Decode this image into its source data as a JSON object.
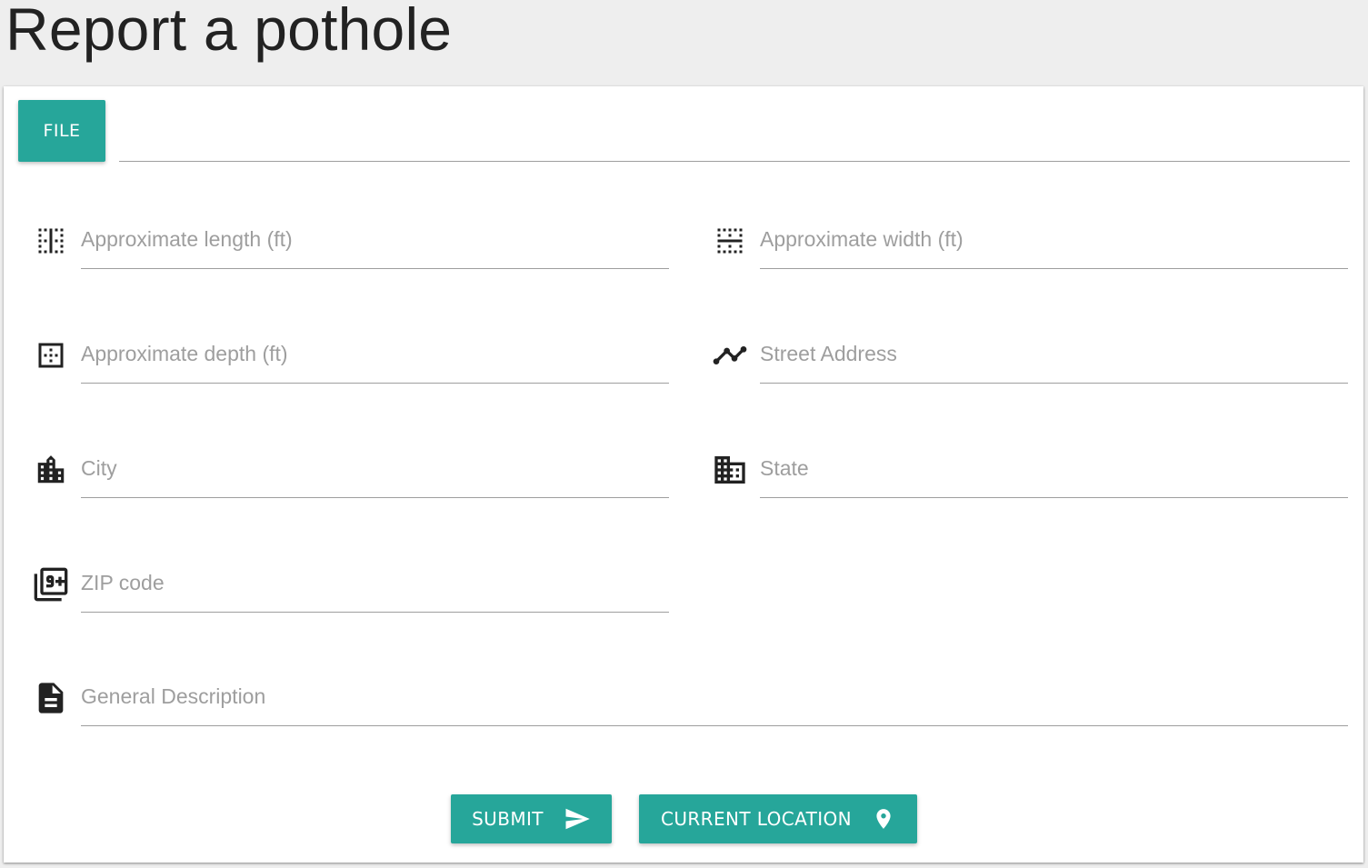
{
  "page": {
    "title": "Report a pothole"
  },
  "colors": {
    "accent": "#26a69a",
    "background": "#eeeeee",
    "card": "#ffffff",
    "label": "#9e9e9e",
    "underline": "#9e9e9e"
  },
  "file_upload": {
    "button_label": "FILE",
    "path_value": ""
  },
  "fields": {
    "length": {
      "placeholder": "Approximate length (ft)",
      "icon": "border-vertical-icon"
    },
    "width": {
      "placeholder": "Approximate width (ft)",
      "icon": "border-horizontal-icon"
    },
    "depth": {
      "placeholder": "Approximate depth (ft)",
      "icon": "border-outer-icon"
    },
    "street": {
      "placeholder": "Street Address",
      "icon": "timeline-icon"
    },
    "city": {
      "placeholder": "City",
      "icon": "city-icon"
    },
    "state": {
      "placeholder": "State",
      "icon": "business-icon"
    },
    "zip": {
      "placeholder": "ZIP code",
      "icon": "filter-9-plus-icon"
    },
    "description": {
      "placeholder": "General Description",
      "icon": "description-icon"
    }
  },
  "actions": {
    "submit": {
      "label": "SUBMIT",
      "icon": "send-icon"
    },
    "location": {
      "label": "CURRENT LOCATION",
      "icon": "place-icon"
    }
  }
}
